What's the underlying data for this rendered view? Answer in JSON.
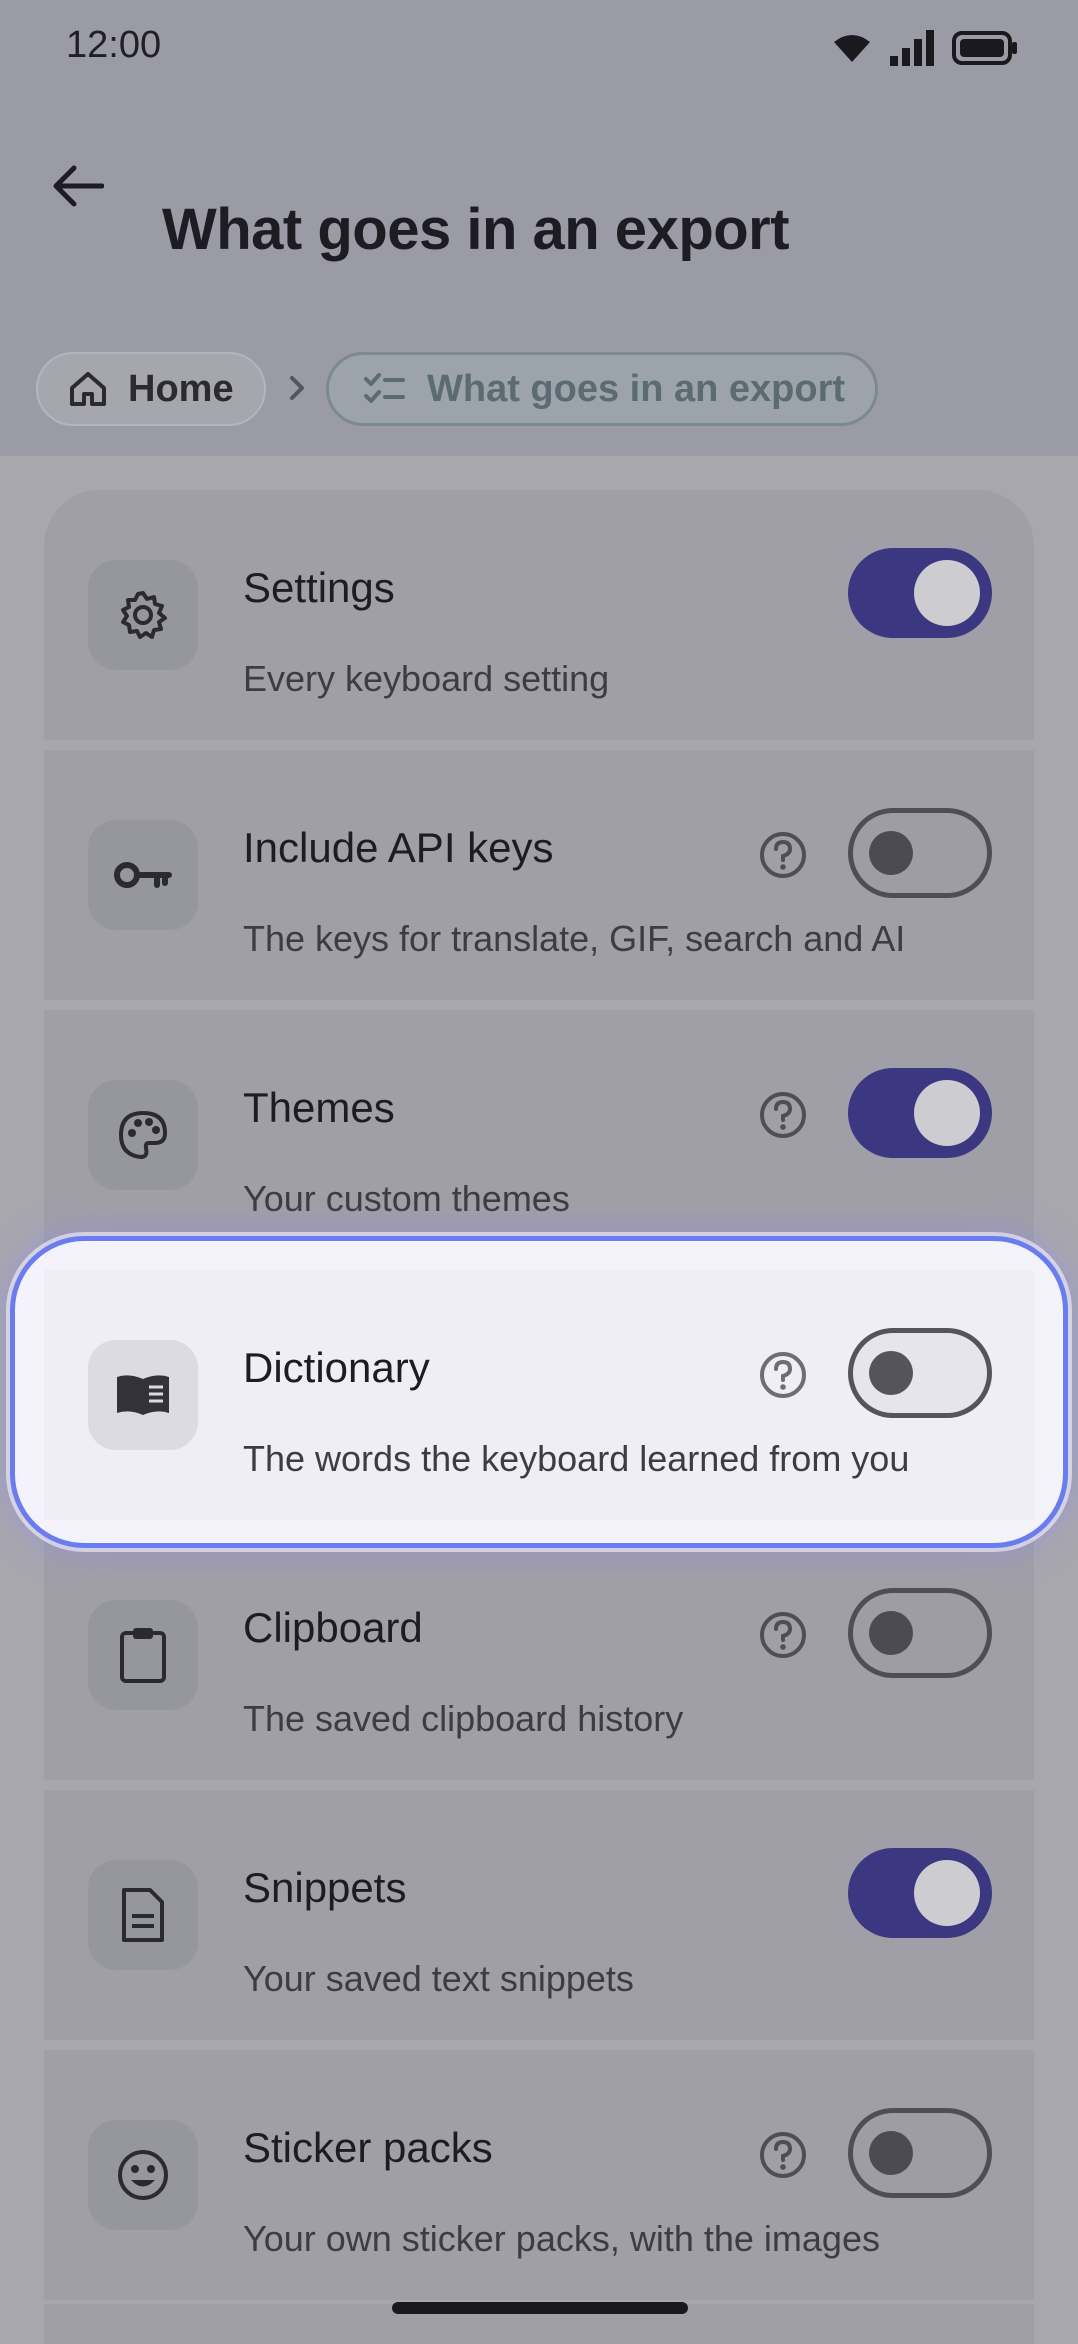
{
  "status_bar": {
    "time": "12:00"
  },
  "header": {
    "title": "What goes in an export",
    "breadcrumb": {
      "home_label": "Home",
      "current_label": "What goes in an export"
    }
  },
  "items": [
    {
      "title": "Settings",
      "subtitle": "Every keyboard setting",
      "icon": "gear-icon",
      "has_help": false,
      "enabled": true
    },
    {
      "title": "Include API keys",
      "subtitle": "The keys for translate, GIF, search and AI",
      "icon": "key-icon",
      "has_help": true,
      "enabled": false
    },
    {
      "title": "Themes",
      "subtitle": "Your custom themes",
      "icon": "palette-icon",
      "has_help": true,
      "enabled": true
    },
    {
      "title": "Dictionary",
      "subtitle": "The words the keyboard learned from you",
      "icon": "book-icon",
      "has_help": true,
      "enabled": false,
      "focused": true
    },
    {
      "title": "Clipboard",
      "subtitle": "The saved clipboard history",
      "icon": "clipboard-icon",
      "has_help": true,
      "enabled": false
    },
    {
      "title": "Snippets",
      "subtitle": "Your saved text snippets",
      "icon": "document-icon",
      "has_help": false,
      "enabled": true
    },
    {
      "title": "Sticker packs",
      "subtitle": "Your own sticker packs, with the images",
      "icon": "smiley-icon",
      "has_help": true,
      "enabled": false
    }
  ],
  "colors": {
    "toggle_on": "#3b3780",
    "focus_ring": "#6a7cf0",
    "focus_background": "#efeef7"
  }
}
